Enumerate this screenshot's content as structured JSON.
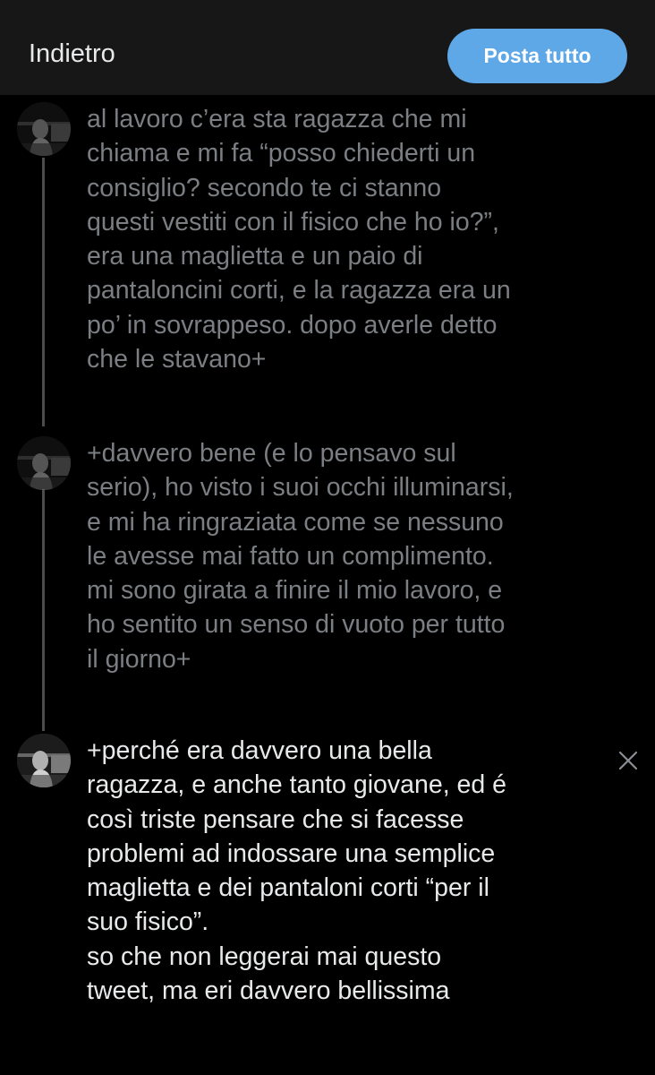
{
  "header": {
    "back_label": "Indietro",
    "post_all_label": "Posta tutto"
  },
  "thread": {
    "tweets": [
      {
        "text": "al lavoro c’era sta ragazza che mi\nchiama e mi fa “posso chiederti un\nconsiglio? secondo te ci stanno\nquesti vestiti con il fisico che ho io?”,\nera una maglietta e un paio di\npantaloncini corti, e la ragazza era un\npo’ in sovrappeso. dopo averle detto\nche le stavano+",
        "state": "dimmed"
      },
      {
        "text": "+davvero bene (e lo pensavo sul\nserio), ho visto i suoi occhi illuminarsi,\ne mi ha ringraziata come se nessuno\nle avesse mai fatto un complimento.\nmi sono girata a finire il mio lavoro, e\nho sentito un senso di vuoto per tutto\nil giorno+",
        "state": "dimmed"
      },
      {
        "text": "+perché era davvero una bella\nragazza, e anche tanto giovane, ed é\ncosì triste pensare che si facesse\nproblemi ad indossare una semplice\nmaglietta e dei pantaloni corti “per il\nsuo fisico”.\nso che non leggerai mai questo\ntweet, ma eri davvero bellissima",
        "state": "active"
      }
    ]
  },
  "icons": {
    "close": "close-icon",
    "avatar": "profile-avatar"
  },
  "colors": {
    "accent": "#5ea8e8",
    "background": "#000000",
    "header": "#171717",
    "text_active": "#e7e9ea",
    "text_dimmed": "#7b7e82",
    "thread_line": "#4a4d50"
  }
}
